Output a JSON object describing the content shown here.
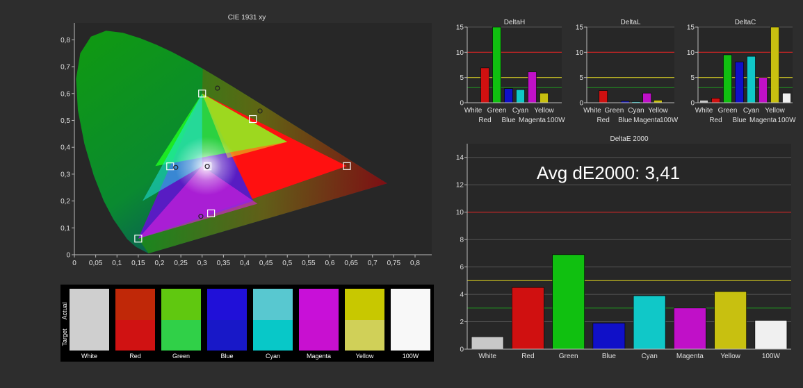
{
  "colors": {
    "white": "#c8c8c8",
    "red": "#d01010",
    "green": "#10c010",
    "blue": "#1010c8",
    "cyan": "#10c8c8",
    "magenta": "#c010c8",
    "yellow": "#c8c010",
    "w100": "#f0f0f0",
    "limit_red": "#d02020",
    "limit_yellow": "#c8c020",
    "limit_green": "#209020"
  },
  "chart_data": [
    {
      "type": "scatter",
      "title": "CIE 1931 xy",
      "xlim": [
        0,
        0.8
      ],
      "ylim": [
        0,
        0.85
      ],
      "x_ticks": [
        "0",
        "0,05",
        "0,1",
        "0,15",
        "0,2",
        "0,25",
        "0,3",
        "0,35",
        "0,4",
        "0,45",
        "0,5",
        "0,55",
        "0,6",
        "0,65",
        "0,7",
        "0,75",
        "0,8"
      ],
      "y_ticks": [
        "0",
        "0,1",
        "0,2",
        "0,3",
        "0,4",
        "0,5",
        "0,6",
        "0,7",
        "0,8"
      ],
      "target_points": [
        {
          "name": "Red",
          "x": 0.64,
          "y": 0.33
        },
        {
          "name": "Green",
          "x": 0.3,
          "y": 0.6
        },
        {
          "name": "Blue",
          "x": 0.15,
          "y": 0.06
        },
        {
          "name": "Cyan",
          "x": 0.225,
          "y": 0.329
        },
        {
          "name": "Magenta",
          "x": 0.321,
          "y": 0.154
        },
        {
          "name": "Yellow",
          "x": 0.419,
          "y": 0.505
        },
        {
          "name": "White",
          "x": 0.3127,
          "y": 0.329
        }
      ],
      "actual_points": [
        {
          "name": "Green",
          "x": 0.336,
          "y": 0.62
        },
        {
          "name": "Yellow",
          "x": 0.436,
          "y": 0.535
        },
        {
          "name": "Cyan",
          "x": 0.238,
          "y": 0.325
        },
        {
          "name": "Magenta",
          "x": 0.297,
          "y": 0.143
        },
        {
          "name": "White",
          "x": 0.312,
          "y": 0.329
        }
      ]
    },
    {
      "type": "bar",
      "title": "DeltaH",
      "categories": [
        "White",
        "Red",
        "Green",
        "Blue",
        "Cyan",
        "Magenta",
        "Yellow",
        "100W"
      ],
      "values": [
        0,
        6.9,
        15,
        2.8,
        2.6,
        6.1,
        1.9,
        0
      ],
      "ylim": [
        0,
        15
      ],
      "y_ticks": [
        "0",
        "5",
        "10",
        "15"
      ]
    },
    {
      "type": "bar",
      "title": "DeltaL",
      "categories": [
        "White",
        "Red",
        "Green",
        "Blue",
        "Cyan",
        "Magenta",
        "Yellow",
        "100W"
      ],
      "values": [
        0,
        2.4,
        0,
        0.3,
        0.2,
        1.9,
        0.5,
        0
      ],
      "ylim": [
        0,
        15
      ],
      "y_ticks": [
        "0",
        "5",
        "10",
        "15"
      ]
    },
    {
      "type": "bar",
      "title": "DeltaC",
      "categories": [
        "White",
        "Red",
        "Green",
        "Blue",
        "Cyan",
        "Magenta",
        "Yellow",
        "100W"
      ],
      "values": [
        0.5,
        0.9,
        9.5,
        8.1,
        9.2,
        5.0,
        15,
        1.9
      ],
      "ylim": [
        0,
        15
      ],
      "y_ticks": [
        "0",
        "5",
        "10",
        "15"
      ]
    },
    {
      "type": "bar",
      "title": "DeltaE 2000",
      "annotation": "Avg dE2000: 3,41",
      "categories": [
        "White",
        "Red",
        "Green",
        "Blue",
        "Cyan",
        "Magenta",
        "Yellow",
        "100W"
      ],
      "values": [
        0.9,
        4.5,
        6.9,
        1.9,
        3.9,
        3.0,
        4.2,
        2.1
      ],
      "ylim": [
        0,
        15
      ],
      "y_ticks": [
        "0",
        "2",
        "4",
        "6",
        "8",
        "10",
        "12",
        "14"
      ]
    }
  ],
  "swatches": {
    "row_labels": [
      "Actual",
      "Target"
    ],
    "items": [
      {
        "label": "White",
        "actual": "#cfcfcf",
        "target": "#cfcfcf"
      },
      {
        "label": "Red",
        "actual": "#c02808",
        "target": "#d01212"
      },
      {
        "label": "Green",
        "actual": "#60c810",
        "target": "#30d048"
      },
      {
        "label": "Blue",
        "actual": "#2010d8",
        "target": "#1818c8"
      },
      {
        "label": "Cyan",
        "actual": "#58c8d0",
        "target": "#08c8c8"
      },
      {
        "label": "Magenta",
        "actual": "#c810d8",
        "target": "#c810d0"
      },
      {
        "label": "Yellow",
        "actual": "#c8c800",
        "target": "#d0d058"
      },
      {
        "label": "100W",
        "actual": "#f8f8f8",
        "target": "#f8f8f8"
      }
    ]
  }
}
